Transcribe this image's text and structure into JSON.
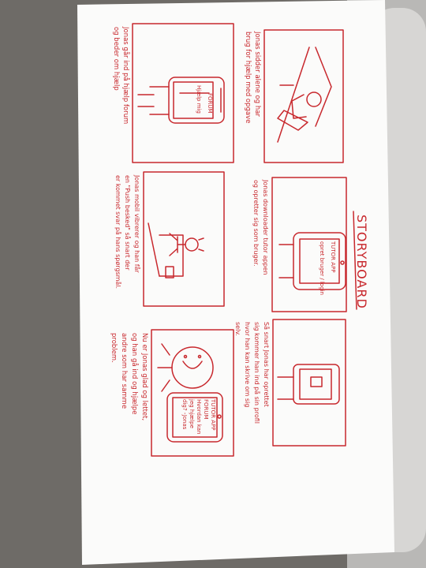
{
  "title": "STORYBOARD",
  "panels": [
    {
      "caption": [
        "Jonas sidder alene og har",
        "brug for hjælp med opgave"
      ]
    },
    {
      "caption": [
        "Jonas går ind på hjælp forum",
        "og beder om hjælp"
      ]
    },
    {
      "caption": [
        "Jonas downloader tutor appen",
        "og opretter sig som bruger."
      ]
    },
    {
      "caption": [
        "Jonas mobil vibrerer og han får",
        "en \"Push besked\" så snart der",
        "er kommet svar på hans spørgsmål."
      ]
    },
    {
      "caption": [
        "Så snart Jonas har oprettet",
        "sig kommer han ind på sin profil",
        "hvor han kan skrive om sig",
        "selv."
      ]
    },
    {
      "caption": [
        "Nu er Jonas glad og lettet,",
        "og han gå ind og hjælpe",
        "andre som har samme",
        "problem."
      ]
    }
  ],
  "phone_screens": {
    "forum": "FORUM",
    "help": "Hjælp mig",
    "tutor": "TUTOR APP",
    "login": "opret bruger / login",
    "answer": [
      "TUTOR APP",
      "FORUM",
      "Hvordan kan",
      "jeg hjælpe",
      "dig? -Jonas"
    ]
  },
  "colors": {
    "ink": "#c8282d",
    "paper": "#fbfbfb",
    "table": "#6f6c68"
  }
}
